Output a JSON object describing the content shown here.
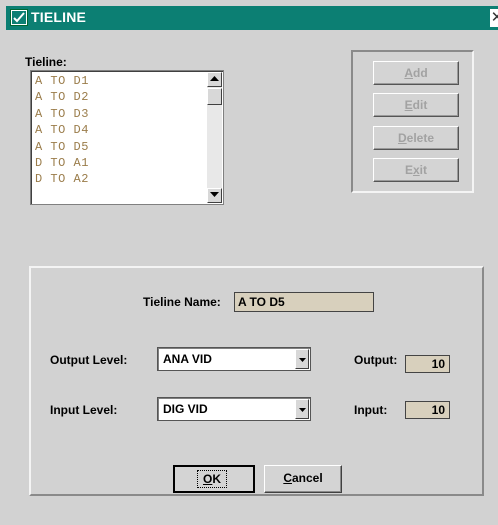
{
  "window": {
    "title": "TIELINE",
    "close_glyph": "✕"
  },
  "list": {
    "label": "Tieline:",
    "items": [
      "A TO D1",
      "A TO D2",
      "A TO D3",
      "A TO D4",
      "A TO D5",
      "D TO A1",
      "D TO A2"
    ]
  },
  "buttons": {
    "add": "Add",
    "edit": "Edit",
    "delete": "Delete",
    "exit": "Exit"
  },
  "form": {
    "tieline_name_label": "Tieline Name:",
    "tieline_name_value": "A TO D5",
    "output_level_label": "Output Level:",
    "output_level_value": "ANA VID",
    "input_level_label": "Input Level:",
    "input_level_value": "DIG VID",
    "output_label": "Output:",
    "output_value": "10",
    "input_label": "Input:",
    "input_value": "10"
  },
  "dialog_buttons": {
    "ok": "OK",
    "cancel": "Cancel"
  },
  "icons": {
    "app": "check-window-icon",
    "scroll_up": "up-arrow-icon",
    "scroll_down": "down-arrow-icon",
    "dropdown": "down-arrow-icon"
  },
  "colors": {
    "title_bar": "#0c7f73",
    "list_text": "#9a7c4a",
    "field_bg": "#d8d0bd"
  }
}
